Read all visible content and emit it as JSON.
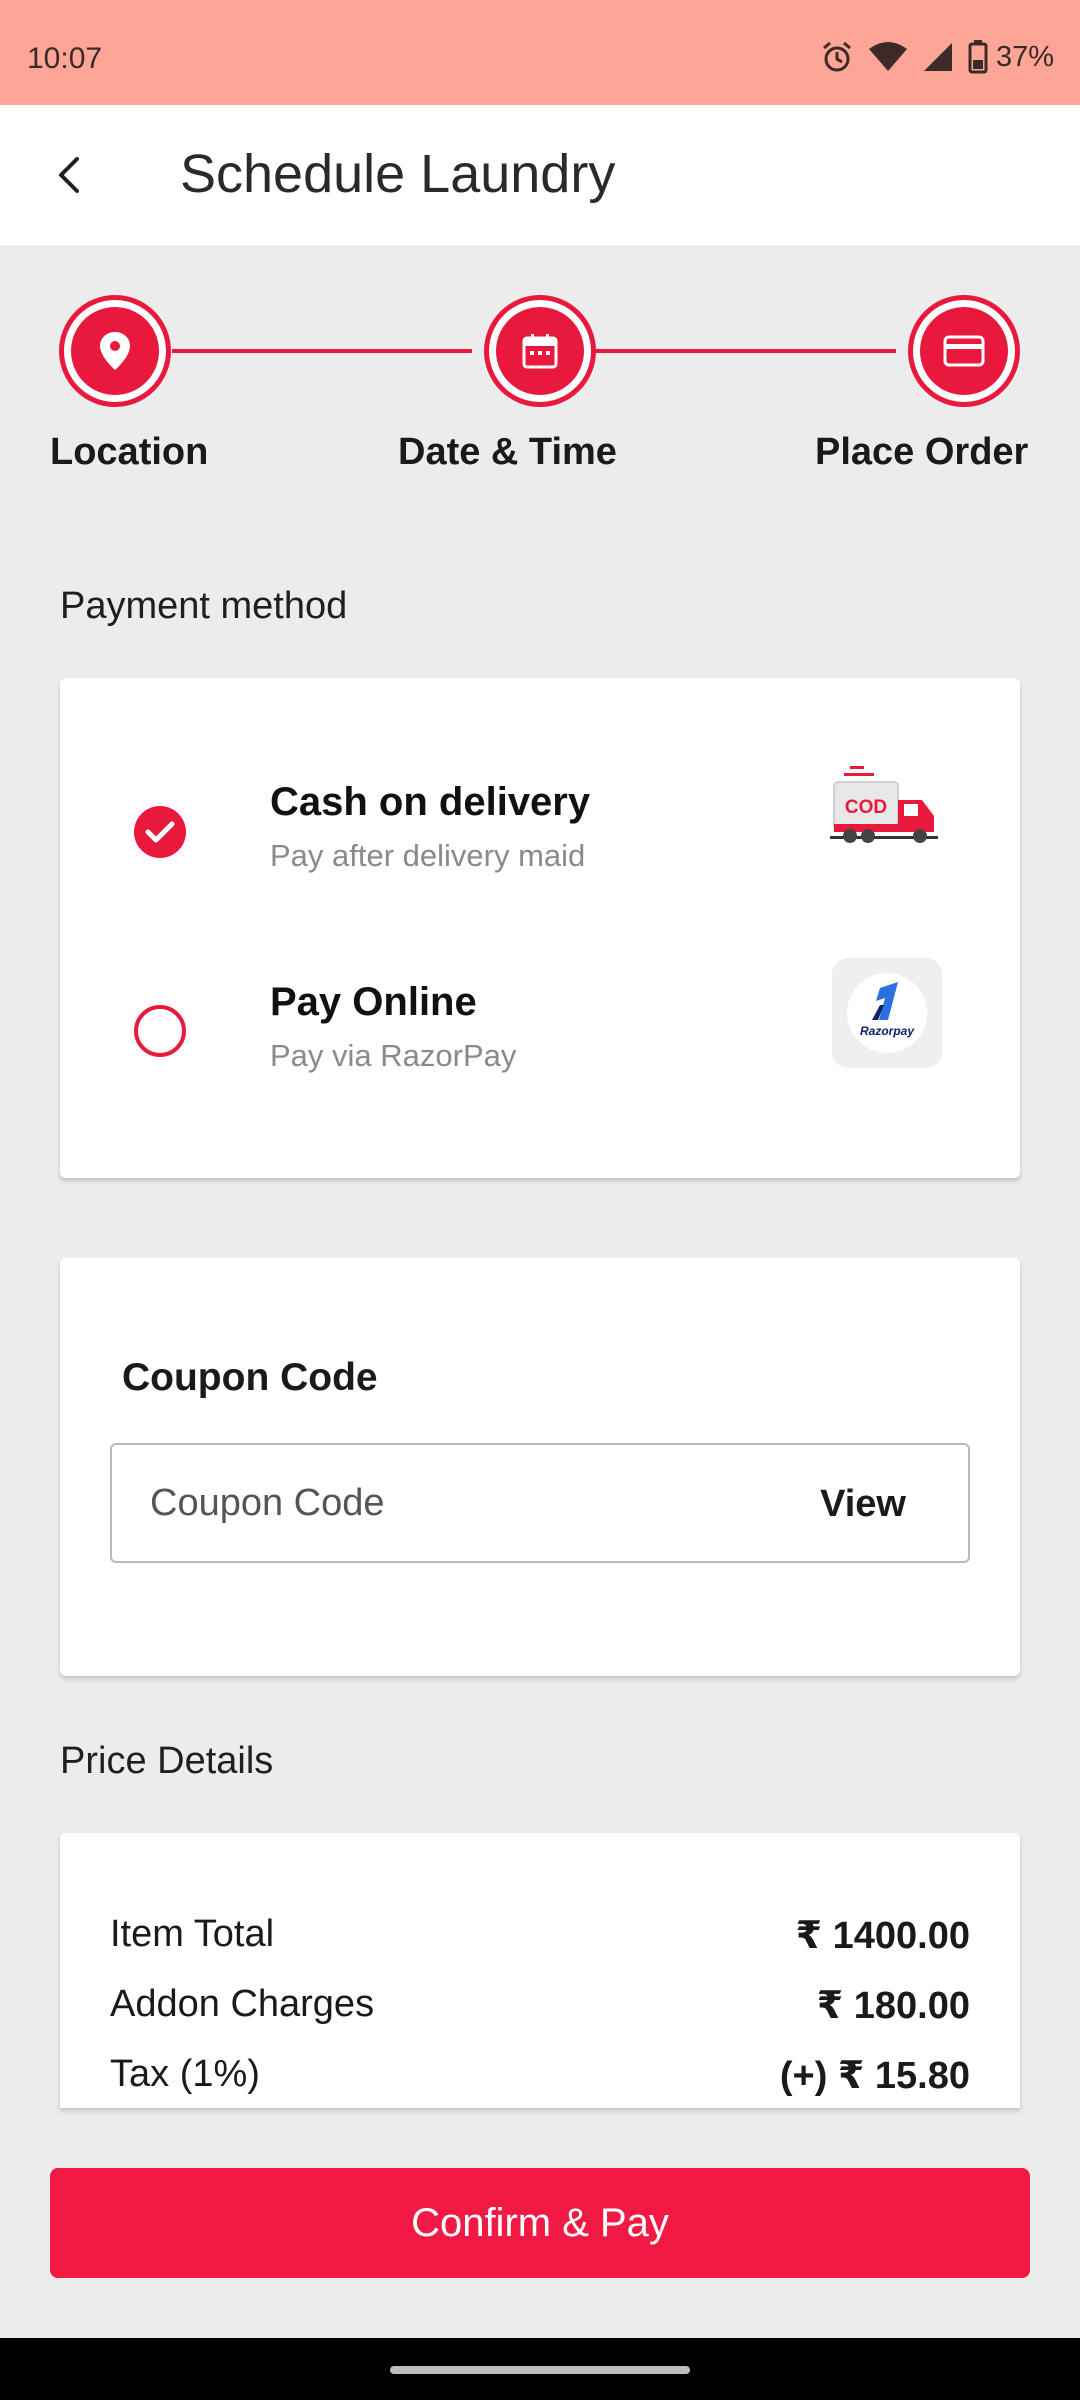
{
  "status_bar": {
    "time": "10:07",
    "battery": "37%",
    "icons": [
      "alarm-icon",
      "wifi-icon",
      "signal-icon",
      "battery-icon"
    ]
  },
  "app_bar": {
    "title": "Schedule Laundry",
    "back_icon": "back-arrow-icon"
  },
  "stepper": {
    "steps": [
      {
        "label": "Location",
        "icon": "location-pin-icon"
      },
      {
        "label": "Date & Time",
        "icon": "calendar-icon"
      },
      {
        "label": "Place Order",
        "icon": "card-icon"
      }
    ]
  },
  "payment": {
    "heading": "Payment method",
    "options": [
      {
        "title": "Cash on delivery",
        "subtitle": "Pay after delivery maid",
        "selected": true,
        "logo_text": "COD",
        "icon": "cod-truck-icon"
      },
      {
        "title": "Pay Online",
        "subtitle": "Pay via RazorPay",
        "selected": false,
        "logo_text": "Razorpay",
        "icon": "razorpay-logo-icon"
      }
    ]
  },
  "coupon": {
    "label": "Coupon Code",
    "placeholder": "Coupon Code",
    "value": "",
    "view_label": "View"
  },
  "price_details": {
    "heading": "Price Details",
    "rows": [
      {
        "label": "Item Total",
        "value": "₹ 1400.00"
      },
      {
        "label": "Addon Charges",
        "value": "₹ 180.00"
      },
      {
        "label": "Tax (1%)",
        "value": "(+) ₹ 15.80"
      }
    ]
  },
  "confirm_button": "Confirm & Pay",
  "colors": {
    "accent": "#e8193c",
    "button": "#f21a45",
    "status_bar": "#fda596",
    "background": "#ececec"
  }
}
